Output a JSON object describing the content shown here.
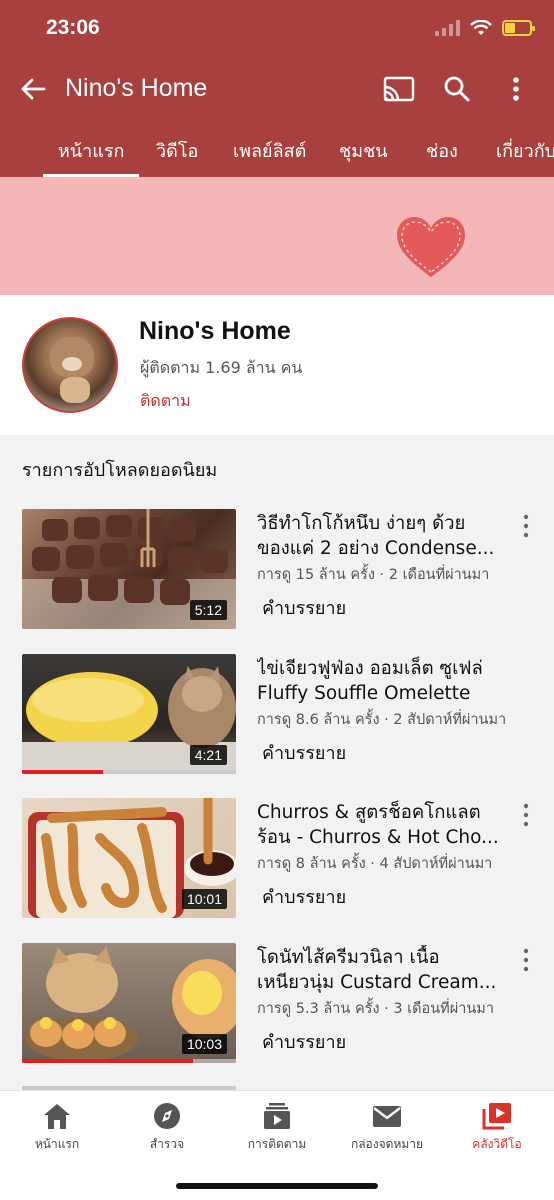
{
  "status_bar": {
    "time": "23:06"
  },
  "app_bar": {
    "title": "Nino's Home"
  },
  "tabs": [
    {
      "label": "หน้าแรก",
      "active": true
    },
    {
      "label": "วิดีโอ"
    },
    {
      "label": "เพลย์ลิสต์"
    },
    {
      "label": "ชุมชน"
    },
    {
      "label": "ช่อง"
    },
    {
      "label": "เกี่ยวกับ"
    }
  ],
  "channel": {
    "name": "Nino's Home",
    "subscribers": "ผู้ติดตาม 1.69 ล้าน คน",
    "subscribe_label": "ติดตาม"
  },
  "section": {
    "title": "รายการอัปโหลดยอดนิยม"
  },
  "videos": [
    {
      "title_line1": "วิธีทำโกโก้หนึบ ง่ายๆ ด้วย",
      "title_line2": "ของแค่ 2 อย่าง Condense...",
      "meta": "การดู 15 ล้าน ครั้ง · 2 เดือนที่ผ่านมา",
      "duration": "5:12",
      "description_label": "คำบรรยาย",
      "watched_fraction": 0
    },
    {
      "title_line1": "ไข่เจียวฟูฟ่อง ออมเล็ต ซูเฟล่",
      "title_line2": "Fluffy Souffle Omelette",
      "meta": "การดู 8.6 ล้าน ครั้ง · 2 สัปดาห์ที่ผ่านมา",
      "duration": "4:21",
      "description_label": "คำบรรยาย",
      "watched_fraction": 0.38
    },
    {
      "title_line1": "Churros & สูตรช็อคโกแลต",
      "title_line2": "ร้อน - Churros & Hot Cho...",
      "meta": "การดู 8 ล้าน ครั้ง · 4 สัปดาห์ที่ผ่านมา",
      "duration": "10:01",
      "description_label": "คำบรรยาย",
      "watched_fraction": 0
    },
    {
      "title_line1": "โดนัทไส้ครีมวนิลา เนื้อ",
      "title_line2": "เหนียวนุ่ม Custard Cream...",
      "meta": "การดู 5.3 ล้าน ครั้ง · 3 เดือนที่ผ่านมา",
      "duration": "10:03",
      "description_label": "คำบรรยาย",
      "watched_fraction": 0.8
    }
  ],
  "bottom_nav": [
    {
      "label": "หน้าแรก",
      "icon": "home-icon"
    },
    {
      "label": "สำรวจ",
      "icon": "explore-icon"
    },
    {
      "label": "การติดตาม",
      "icon": "subscriptions-icon"
    },
    {
      "label": "กล่องจดหมาย",
      "icon": "inbox-icon"
    },
    {
      "label": "คลังวิดีโอ",
      "icon": "library-icon",
      "active": true
    }
  ],
  "colors": {
    "brand": "#a8403f",
    "banner": "#f4b6b6",
    "accent": "#d93327"
  }
}
